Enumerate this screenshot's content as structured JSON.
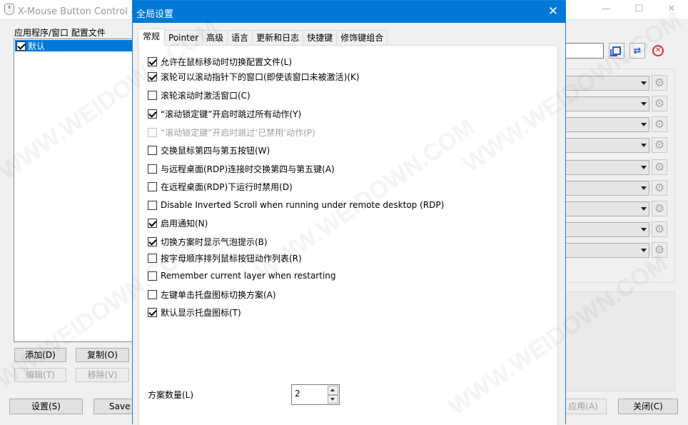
{
  "bg_window": {
    "title": "X-Mouse Button Control - 设",
    "controls": {
      "minimize": "—",
      "maximize": "☐",
      "close": "✕"
    },
    "profiles_label": "应用程序/窗口 配置文件",
    "profiles": [
      {
        "label": "默认",
        "checked": true
      }
    ],
    "buttons": {
      "add": "添加(D)",
      "copy": "复制(O)",
      "edit": "编辑(T)",
      "remove": "移除(V)",
      "settings": "设置(S)",
      "save": "Save P",
      "apply": "应用(A)",
      "close": "关闭(C)"
    },
    "gear_glyph": "⚙"
  },
  "dialog": {
    "title": "全局设置",
    "close_glyph": "✕",
    "tabs": [
      "常规",
      "Pointer",
      "高级",
      "语言",
      "更新和日志",
      "快捷键",
      "修饰键组合"
    ],
    "active_tab": "常规",
    "options": [
      {
        "label": "允许在鼠标移动时切换配置文件(L)",
        "checked": true,
        "enabled": true
      },
      {
        "label": "滚轮可以滚动指针下的窗口(即使该窗口未被激活)(K)",
        "checked": true,
        "enabled": true
      },
      {
        "label": "滚轮滚动时激活窗口(C)",
        "checked": false,
        "enabled": true
      },
      {
        "label": "“滚动锁定键”开启时跳过所有动作(Y)",
        "checked": true,
        "enabled": true
      },
      {
        "label": "“滚动锁定键”开启时跳过‘已禁用’动作(P)",
        "checked": false,
        "enabled": false
      },
      {
        "label": "交换鼠标第四与第五按钮(W)",
        "checked": false,
        "enabled": true
      },
      {
        "label": "与远程桌面(RDP)连接时交换第四与第五键(A)",
        "checked": false,
        "enabled": true
      },
      {
        "label": "在远程桌面(RDP)下运行时禁用(D)",
        "checked": false,
        "enabled": true
      },
      {
        "label": "Disable Inverted Scroll when running under remote desktop (RDP)",
        "checked": false,
        "enabled": true
      },
      {
        "label": "启用通知(N)",
        "checked": true,
        "enabled": true
      },
      {
        "label": "切换方案时显示气泡提示(B)",
        "checked": true,
        "enabled": true
      },
      {
        "label": "按字母顺序排列鼠标按钮动作列表(R)",
        "checked": false,
        "enabled": true
      },
      {
        "label": "Remember current layer when restarting",
        "checked": false,
        "enabled": true
      },
      {
        "label": "左键单击托盘图标切换方案(A)",
        "checked": false,
        "enabled": true
      },
      {
        "label": "默认显示托盘图标(T)",
        "checked": true,
        "enabled": true
      }
    ],
    "scheme_count_label": "方案数量(L)",
    "scheme_count_value": "2"
  },
  "watermark_text": "WWW.WEIDOWN.COM",
  "colors": {
    "accent": "#0078d7",
    "selection": "#0078d7",
    "delete": "#e03030",
    "copy_icon": "#2b5fd9"
  }
}
